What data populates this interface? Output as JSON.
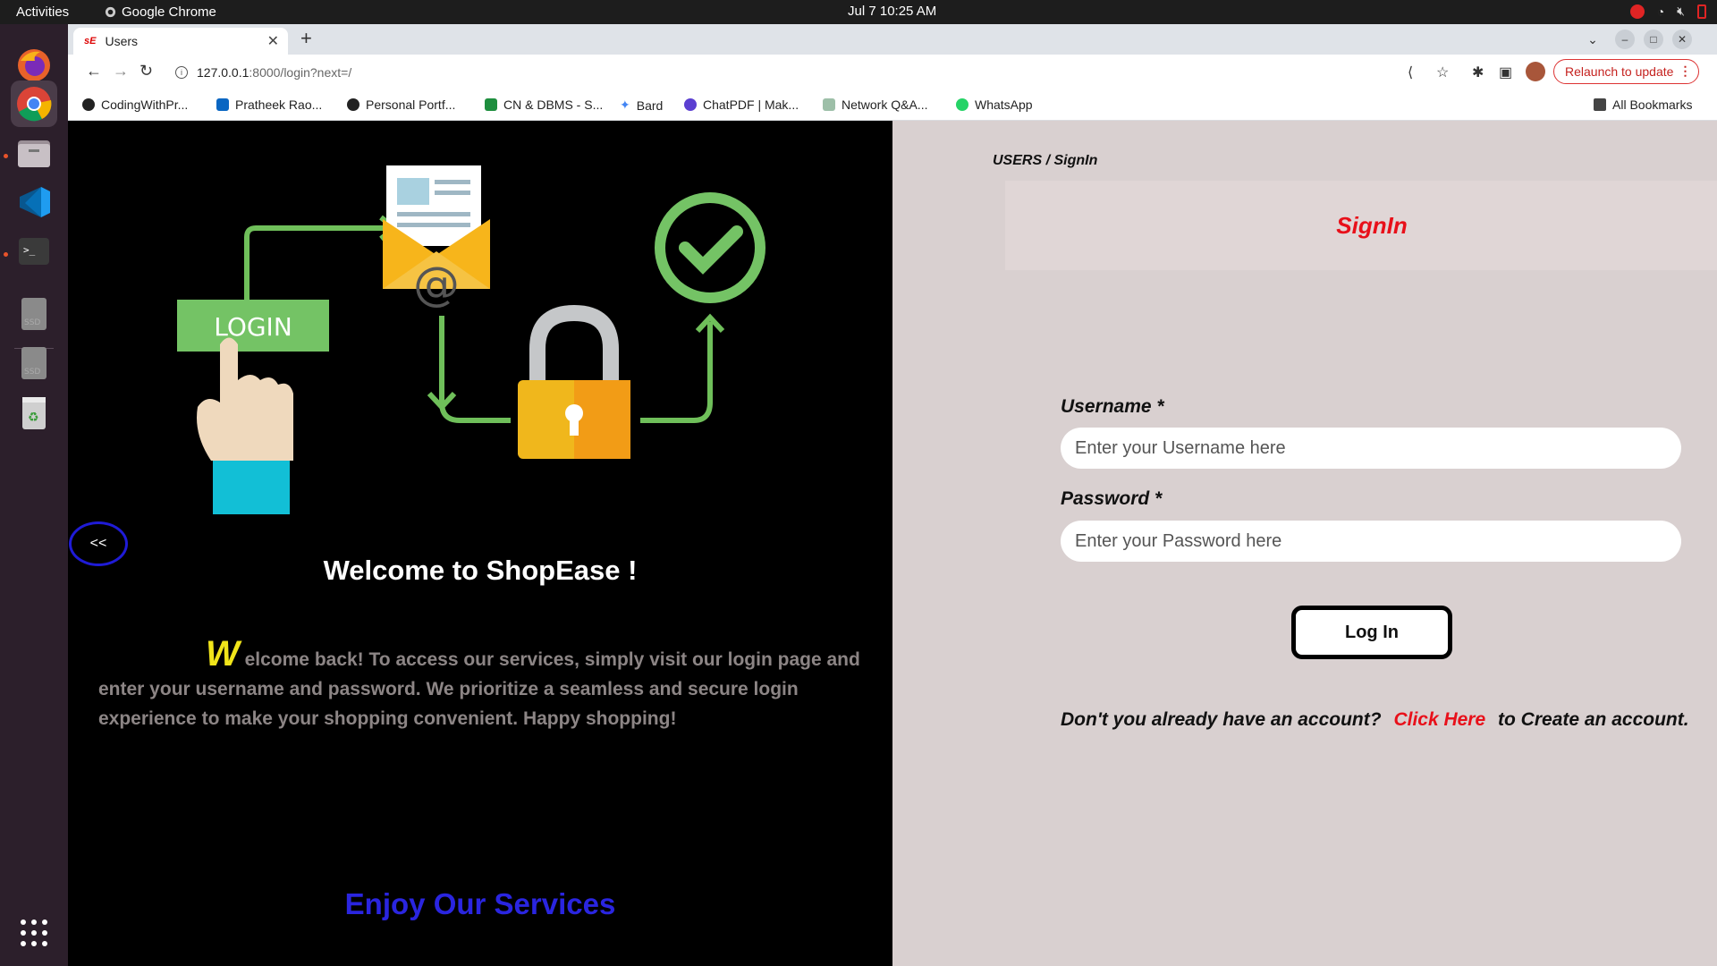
{
  "system_bar": {
    "activities": "Activities",
    "app_name": "Google Chrome",
    "clock": "Jul 7  10:25 AM"
  },
  "browser": {
    "tab_title": "Users",
    "tab_favicon_text": "sE",
    "url_host": "127.0.0.1",
    "url_path": ":8000/login?next=/",
    "relaunch_label": "Relaunch to update",
    "bookmarks": [
      {
        "label": "CodingWithPr...",
        "icon": "github-icon"
      },
      {
        "label": "Pratheek Rao...",
        "icon": "linkedin-icon"
      },
      {
        "label": "Personal Portf...",
        "icon": "github-icon"
      },
      {
        "label": "CN & DBMS - S...",
        "icon": "classroom-icon"
      },
      {
        "label": "Bard",
        "icon": "sparkle-icon"
      },
      {
        "label": "ChatPDF | Mak...",
        "icon": "chatpdf-icon"
      },
      {
        "label": "Network Q&A...",
        "icon": "network-icon"
      },
      {
        "label": "WhatsApp",
        "icon": "whatsapp-icon"
      }
    ],
    "all_bookmarks": "All Bookmarks"
  },
  "left_panel": {
    "illustration": {
      "login_button_text": "LOGIN",
      "at_symbol": "@"
    },
    "back_button": "<<",
    "welcome_title": "Welcome to ShopEase !",
    "welcome_dropcap": "W",
    "welcome_text": "elcome back! To access our services, simply visit our login page and enter your username and password. We prioritize a seamless and secure login experience to make your shopping convenient. Happy shopping!",
    "enjoy": "Enjoy Our Services"
  },
  "right_panel": {
    "breadcrumb": "USERS / SignIn",
    "heading": "SignIn",
    "username_label": "Username *",
    "username_placeholder": "Enter your Username here",
    "password_label": "Password *",
    "password_placeholder": "Enter your Password here",
    "login_button": "Log In",
    "signup_prefix": "Don't you already have an account?",
    "signup_link": "Click Here",
    "signup_suffix": "to Create an account."
  },
  "colors": {
    "accent_red": "#e8101a",
    "accent_blue": "#2a25e0",
    "dropcap_yellow": "#f1e51a",
    "illustration_green": "#6fbf5a"
  }
}
